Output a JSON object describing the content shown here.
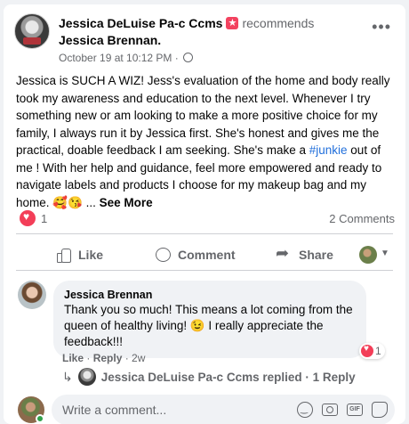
{
  "post": {
    "author": "Jessica DeLuise Pa-c Ccms",
    "recommends_label": "recommends",
    "recommended": "Jessica Brennan",
    "date": "October 19 at 10:12 PM",
    "body_part1": "Jessica is SUCH A WIZ! Jess's evaluation of the home and body really took my awareness and education to the next level. Whenever I try something new or am looking to make a more positive choice for my family, I always run it by Jessica first. She's honest and gives me the practical, doable feedback I am seeking. She's make a ",
    "hashtag": "#junkie",
    "body_part2": " out of me ! With her help and guidance, feel more empowered and ready to navigate labels and products I choose for my makeup bag and my home. 🥰😘 ... ",
    "see_more": "See More",
    "reaction_count": "1",
    "comments_count": "2 Comments"
  },
  "actions": {
    "like": "Like",
    "comment": "Comment",
    "share": "Share"
  },
  "comment": {
    "author": "Jessica Brennan",
    "text": "Thank you so much! This means a lot coming from the queen of healthy living! 😉 I really appreciate the feedback!!!",
    "reaction_count": "1",
    "like": "Like",
    "reply": "Reply",
    "age": "2w",
    "replies_text": "Jessica DeLuise Pa-c Ccms replied · 1 Reply"
  },
  "composer": {
    "placeholder": "Write a comment..."
  },
  "icons": [
    "recommend-icon",
    "globe-icon",
    "more-icon",
    "love-reaction-icon",
    "like-icon",
    "comment-icon",
    "share-icon",
    "emoji-icon",
    "camera-icon",
    "gif-icon",
    "sticker-icon"
  ],
  "colors": {
    "link": "#216fdb",
    "love": "#f33e58",
    "secondary_text": "#65676b",
    "online": "#31a24c"
  }
}
